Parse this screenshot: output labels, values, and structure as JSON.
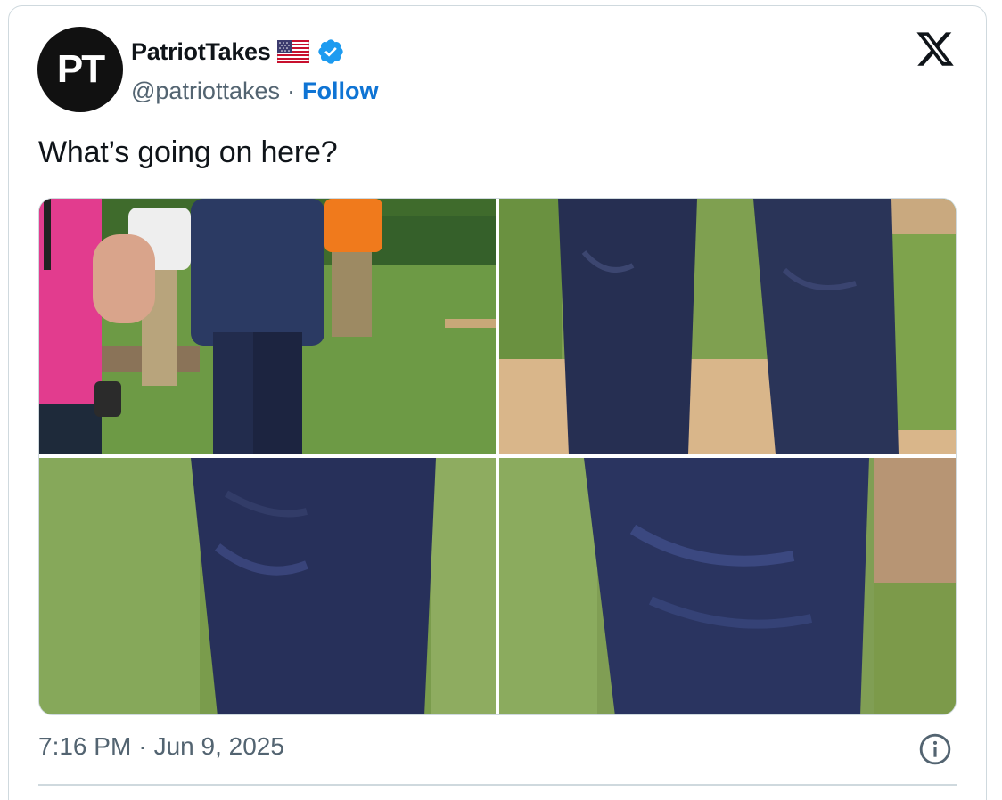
{
  "tweet": {
    "avatar_initials": "PT",
    "display_name": "PatriotTakes",
    "flag_emoji": "🇺🇸",
    "handle": "@patriottakes",
    "separator": "·",
    "follow_label": "Follow",
    "text": "What’s going on here?",
    "time": "7:16 PM",
    "date": "Jun 9, 2025",
    "platform_icon": "x-logo-icon",
    "info_icon": "info-icon",
    "verified_icon": "verified-badge-icon"
  },
  "media": {
    "count": 4,
    "tiles": [
      {
        "description_icon": "photo-tile"
      },
      {
        "description_icon": "photo-tile"
      },
      {
        "description_icon": "photo-tile"
      },
      {
        "description_icon": "photo-tile"
      }
    ]
  },
  "colors": {
    "follow": "#0f74d4",
    "muted": "#536471",
    "border": "#cfd9de",
    "verified": "#1d9bf0"
  }
}
